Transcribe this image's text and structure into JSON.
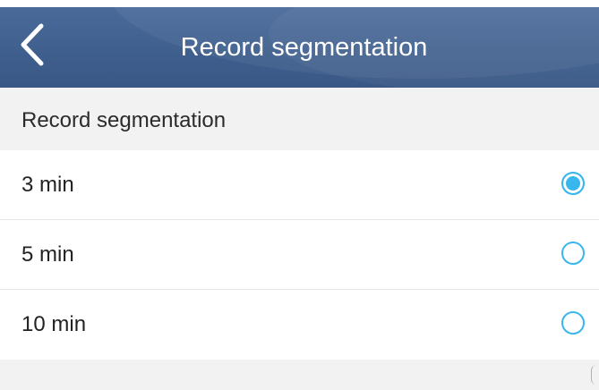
{
  "app_bar": {
    "title": "Record segmentation",
    "back_icon": "chevron-left-icon",
    "background_color": "#3f5f8e"
  },
  "section": {
    "header": "Record segmentation"
  },
  "options": [
    {
      "label": "3 min",
      "selected": true
    },
    {
      "label": "5 min",
      "selected": false
    },
    {
      "label": "10 min",
      "selected": false
    }
  ],
  "accent_color": "#38b6ee"
}
